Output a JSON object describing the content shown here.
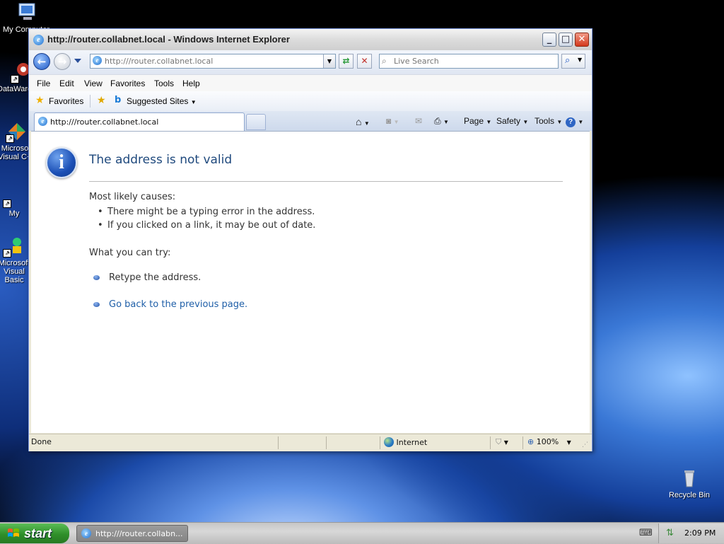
{
  "desktop": {
    "icons": [
      {
        "label": "My Computer"
      },
      {
        "label": "DataWarehouse"
      },
      {
        "label": "Microsoft Visual C++"
      },
      {
        "label": "My"
      },
      {
        "label": "Microsoft Visual Basic"
      },
      {
        "label": "Recycle Bin"
      }
    ]
  },
  "window": {
    "title": "http://router.collabnet.local - Windows Internet Explorer",
    "address": {
      "placeholder": "http:///router.collabnet.local"
    },
    "search": {
      "placeholder": "Live Search"
    },
    "menu": [
      "File",
      "Edit",
      "View",
      "Favorites",
      "Tools",
      "Help"
    ],
    "favorites_label": "Favorites",
    "suggested_sites_label": "Suggested Sites",
    "tab_title": "http:///router.collabnet.local",
    "commands": {
      "page": "Page",
      "safety": "Safety",
      "tools": "Tools"
    }
  },
  "content": {
    "heading": "The address is not valid",
    "causes_label": "Most likely causes:",
    "causes": [
      "There might be a typing error in the address.",
      "If you clicked on a link, it may be out of date."
    ],
    "try_label": "What you can try:",
    "try_items": [
      "Retype the address.",
      "Go back to the previous page."
    ]
  },
  "status": {
    "text": "Done",
    "zone": "Internet",
    "zoom": "100%"
  },
  "taskbar": {
    "start": "start",
    "task": "http:///router.collabn...",
    "clock": "2:09 PM"
  }
}
